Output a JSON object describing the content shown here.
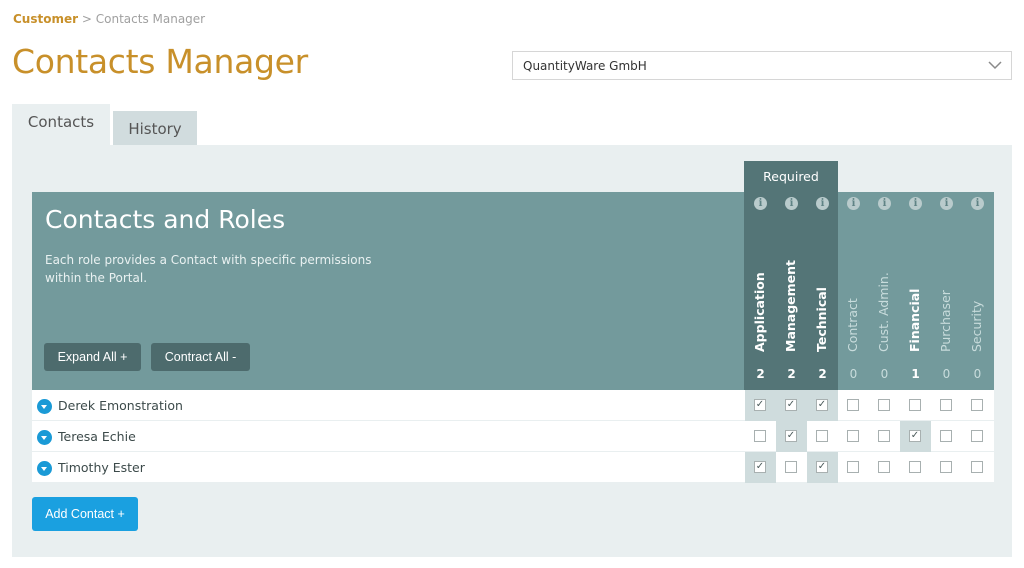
{
  "breadcrumb": {
    "root": "Customer",
    "separator": ">",
    "current": "Contacts Manager"
  },
  "page_title": "Contacts Manager",
  "company_select": {
    "value": "QuantityWare GmbH",
    "icon": "chevron-down-icon"
  },
  "tabs": [
    {
      "label": "Contacts",
      "active": true
    },
    {
      "label": "History",
      "active": false
    }
  ],
  "hero": {
    "title": "Contacts and Roles",
    "description": "Each role provides a Contact with specific permissions within the Portal.",
    "expand_all_label": "Expand All +",
    "contract_all_label": "Contract All -"
  },
  "required_label": "Required",
  "info_glyph": "i",
  "roles": [
    {
      "label": "Application",
      "count": "2",
      "bold": true
    },
    {
      "label": "Management",
      "count": "2",
      "bold": true
    },
    {
      "label": "Technical",
      "count": "2",
      "bold": true
    },
    {
      "label": "Contract",
      "count": "0",
      "bold": false
    },
    {
      "label": "Cust. Admin.",
      "count": "0",
      "bold": false
    },
    {
      "label": "Financial",
      "count": "1",
      "bold": true
    },
    {
      "label": "Purchaser",
      "count": "0",
      "bold": false
    },
    {
      "label": "Security",
      "count": "0",
      "bold": false
    }
  ],
  "contacts": [
    {
      "name": "Derek Emonstration",
      "roles": [
        true,
        true,
        true,
        false,
        false,
        false,
        false,
        false
      ]
    },
    {
      "name": "Teresa Echie",
      "roles": [
        false,
        true,
        false,
        false,
        false,
        true,
        false,
        false
      ]
    },
    {
      "name": "Timothy Ester",
      "roles": [
        true,
        false,
        true,
        false,
        false,
        false,
        false,
        false
      ]
    }
  ],
  "add_contact_label": "Add Contact +",
  "colors": {
    "accent": "#c8902a",
    "hero": "#739a9c",
    "required_band": "#547577",
    "primary_button": "#1aa0e0"
  }
}
